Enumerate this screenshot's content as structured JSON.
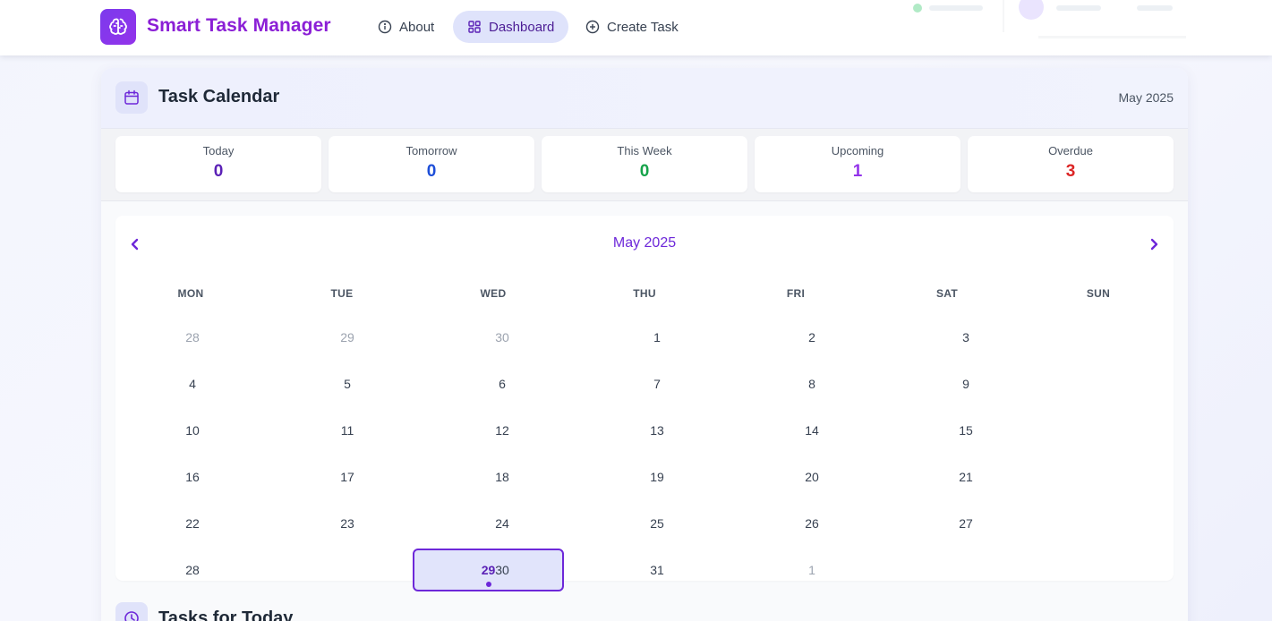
{
  "app": {
    "title": "Smart Task Manager",
    "brand_color": "#8b1fd6"
  },
  "nav": {
    "items": [
      {
        "label": "About",
        "icon": "info-icon"
      },
      {
        "label": "Dashboard",
        "icon": "grid-icon",
        "active": true
      },
      {
        "label": "Create Task",
        "icon": "plus-circle-icon"
      }
    ]
  },
  "calendar_card": {
    "title": "Task Calendar",
    "month_label": "May 2025",
    "icon": "calendar-icon"
  },
  "stats": [
    {
      "label": "Today",
      "value": "0",
      "color": "#5b21b6"
    },
    {
      "label": "Tomorrow",
      "value": "0",
      "color": "#1d4ed8"
    },
    {
      "label": "This Week",
      "value": "0",
      "color": "#16a34a"
    },
    {
      "label": "Upcoming",
      "value": "1",
      "color": "#9333ea"
    },
    {
      "label": "Overdue",
      "value": "3",
      "color": "#dc2626"
    }
  ],
  "calendar": {
    "month_title": "May 2025",
    "weekdays": [
      "MON",
      "TUE",
      "WED",
      "THU",
      "FRI",
      "SAT",
      "SUN"
    ],
    "weeks": [
      [
        {
          "d": "28",
          "muted": true
        },
        {
          "d": "29",
          "muted": true
        },
        {
          "d": "30",
          "muted": true
        },
        {
          "d": "1"
        },
        {
          "d": "2"
        },
        {
          "d": "3"
        }
      ],
      [
        {
          "d": "4"
        },
        {
          "d": "5"
        },
        {
          "d": "6"
        },
        {
          "d": "7"
        },
        {
          "d": "8"
        },
        {
          "d": "9"
        }
      ],
      [
        {
          "d": "10"
        },
        {
          "d": "11"
        },
        {
          "d": "12"
        },
        {
          "d": "13"
        },
        {
          "d": "14"
        },
        {
          "d": "15"
        }
      ],
      [
        {
          "d": "16"
        },
        {
          "d": "17"
        },
        {
          "d": "18"
        },
        {
          "d": "19"
        },
        {
          "d": "20"
        },
        {
          "d": "21"
        }
      ],
      [
        {
          "d": "22"
        },
        {
          "d": "23"
        },
        {
          "d": "24"
        },
        {
          "d": "25"
        },
        {
          "d": "26"
        },
        {
          "d": "27"
        }
      ],
      [
        {
          "d": "28"
        },
        {
          "d": "29",
          "selected": true
        },
        {
          "d": "30"
        },
        {
          "d": "31"
        },
        {
          "d": "1",
          "muted": true
        }
      ]
    ],
    "accent_color": "#6d28d9"
  },
  "tasks_section": {
    "title": "Tasks for Today",
    "icon": "clock-icon"
  }
}
